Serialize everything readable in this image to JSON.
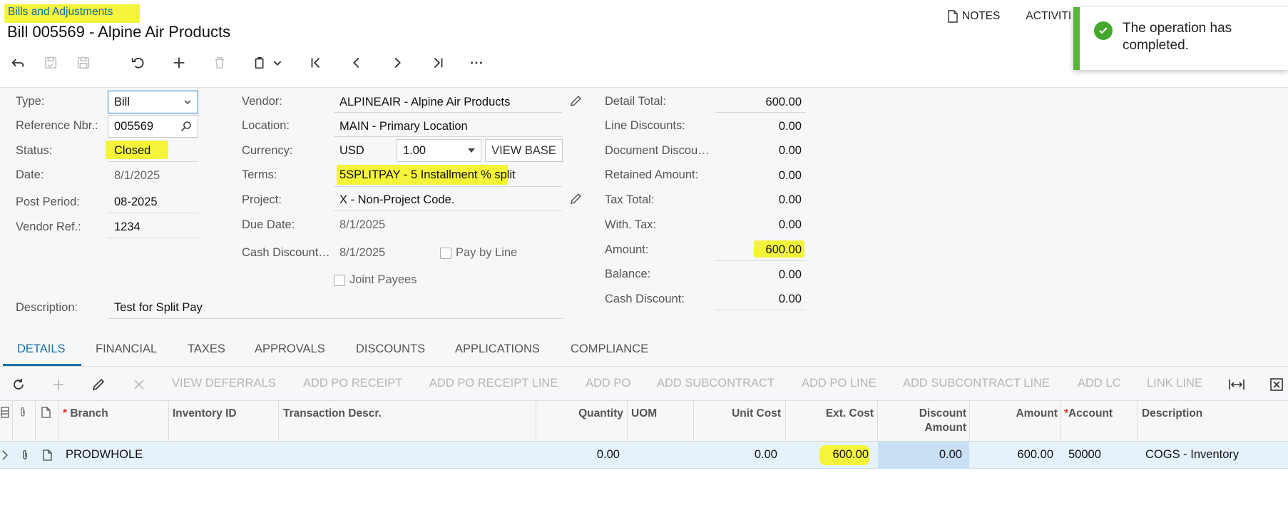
{
  "header": {
    "breadcrumb": "Bills and Adjustments",
    "title": "Bill 005569 - Alpine Air Products",
    "notes_label": "NOTES",
    "activities_label": "ACTIVITI"
  },
  "toolbar": {
    "icons": [
      "undo-icon",
      "save-close-icon",
      "save-icon",
      "cancel-icon",
      "add-icon",
      "delete-icon",
      "copy-paste-icon",
      "first-record-icon",
      "previous-icon",
      "next-icon",
      "last-record-icon",
      "more-icon"
    ]
  },
  "toast": {
    "message": "The operation has completed."
  },
  "form": {
    "type": {
      "label": "Type:",
      "value": "Bill"
    },
    "reference_nbr": {
      "label": "Reference Nbr.:",
      "value": "005569"
    },
    "status": {
      "label": "Status:",
      "value": "Closed"
    },
    "date": {
      "label": "Date:",
      "value": "8/1/2025"
    },
    "post_period": {
      "label": "Post Period:",
      "value": "08-2025"
    },
    "vendor_ref": {
      "label": "Vendor Ref.:",
      "value": "1234"
    },
    "description": {
      "label": "Description:",
      "value": "Test for Split Pay"
    },
    "vendor": {
      "label": "Vendor:",
      "value": "ALPINEAIR - Alpine Air Products"
    },
    "location": {
      "label": "Location:",
      "value": "MAIN - Primary Location"
    },
    "currency": {
      "label": "Currency:",
      "code": "USD",
      "rate": "1.00",
      "view_base": "VIEW BASE"
    },
    "terms": {
      "label": "Terms:",
      "value": "5SPLITPAY - 5 Installment % split"
    },
    "project": {
      "label": "Project:",
      "value": "X - Non-Project Code."
    },
    "due_date": {
      "label": "Due Date:",
      "value": "8/1/2025"
    },
    "cash_discount_date": {
      "label": "Cash Discount…",
      "value": "8/1/2025"
    },
    "pay_by_line": {
      "label": "Pay by Line",
      "checked": false
    },
    "joint_payees": {
      "label": "Joint Payees",
      "checked": false
    }
  },
  "totals": {
    "detail_total": {
      "label": "Detail Total:",
      "value": "600.00"
    },
    "line_discounts": {
      "label": "Line Discounts:",
      "value": "0.00"
    },
    "document_discount": {
      "label": "Document Discou…",
      "value": "0.00"
    },
    "retained_amount": {
      "label": "Retained Amount:",
      "value": "0.00"
    },
    "tax_total": {
      "label": "Tax Total:",
      "value": "0.00"
    },
    "with_tax": {
      "label": "With. Tax:",
      "value": "0.00"
    },
    "amount": {
      "label": "Amount:",
      "value": "600.00"
    },
    "balance": {
      "label": "Balance:",
      "value": "0.00"
    },
    "cash_discount": {
      "label": "Cash Discount:",
      "value": "0.00"
    }
  },
  "tabs": [
    "DETAILS",
    "FINANCIAL",
    "TAXES",
    "APPROVALS",
    "DISCOUNTS",
    "APPLICATIONS",
    "COMPLIANCE"
  ],
  "grid_toolbar": [
    "VIEW DEFERRALS",
    "ADD PO RECEIPT",
    "ADD PO RECEIPT LINE",
    "ADD PO",
    "ADD SUBCONTRACT",
    "ADD PO LINE",
    "ADD SUBCONTRACT LINE",
    "ADD LC",
    "LINK LINE"
  ],
  "grid": {
    "columns": {
      "branch": "Branch",
      "inventory_id": "Inventory ID",
      "transaction_descr": "Transaction Descr.",
      "quantity": "Quantity",
      "uom": "UOM",
      "unit_cost": "Unit Cost",
      "ext_cost": "Ext. Cost",
      "discount_amount_1": "Discount",
      "discount_amount_2": "Amount",
      "amount": "Amount",
      "account": "Account",
      "description": "Description"
    },
    "rows": [
      {
        "branch": "PRODWHOLE",
        "inventory_id": "",
        "transaction_descr": "",
        "quantity": "0.00",
        "uom": "",
        "unit_cost": "0.00",
        "ext_cost": "600.00",
        "discount_amount": "0.00",
        "amount": "600.00",
        "account": "50000",
        "description": "COGS - Inventory"
      }
    ]
  },
  "colors": {
    "accent": "#1a6fa9",
    "highlight": "#f4f43a",
    "success": "#44a82c",
    "row_selected": "#e6f2fa"
  }
}
